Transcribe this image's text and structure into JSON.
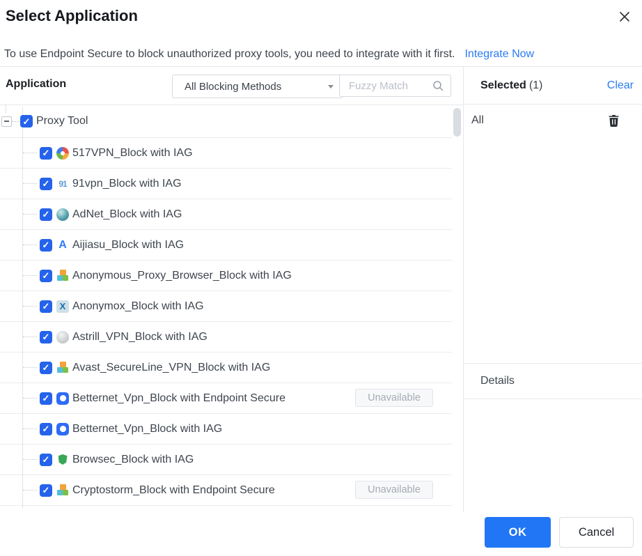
{
  "dialog": {
    "title": "Select Application"
  },
  "info": {
    "message": "To use Endpoint Secure to block unauthorized proxy tools, you need to integrate with it first.",
    "link_label": "Integrate Now"
  },
  "left": {
    "header": "Application",
    "dropdown_value": "All Blocking Methods",
    "search_placeholder": "Fuzzy Match"
  },
  "tree": {
    "parent": {
      "label": "Proxy Tool",
      "checked": true,
      "expanded": true
    },
    "children": [
      {
        "icon": "pinwheel-icon",
        "label": "517VPN_Block with IAG",
        "checked": true
      },
      {
        "icon": "vpn91-icon",
        "label": "91vpn_Block with IAG",
        "checked": true
      },
      {
        "icon": "globe-icon",
        "label": "AdNet_Block with IAG",
        "checked": true
      },
      {
        "icon": "letter-a-icon",
        "label": "Aijiasu_Block with IAG",
        "checked": true
      },
      {
        "icon": "cubes-icon",
        "label": "Anonymous_Proxy_Browser_Block with IAG",
        "checked": true
      },
      {
        "icon": "x-square-icon",
        "label": "Anonymox_Block with IAG",
        "checked": true
      },
      {
        "icon": "sphere-icon",
        "label": "Astrill_VPN_Block with IAG",
        "checked": true
      },
      {
        "icon": "cubes-icon",
        "label": "Avast_SecureLine_VPN_Block with IAG",
        "checked": true
      },
      {
        "icon": "shield-face-icon",
        "label": "Betternet_Vpn_Block with Endpoint Secure",
        "checked": true,
        "badge": "Unavailable"
      },
      {
        "icon": "shield-face-icon",
        "label": "Betternet_Vpn_Block with IAG",
        "checked": true
      },
      {
        "icon": "green-shield-icon",
        "label": "Browsec_Block with IAG",
        "checked": true
      },
      {
        "icon": "cubes-icon",
        "label": "Cryptostorm_Block with Endpoint Secure",
        "checked": true,
        "badge": "Unavailable"
      }
    ]
  },
  "right": {
    "selected_label": "Selected",
    "selected_count": "(1)",
    "clear_label": "Clear",
    "items": [
      {
        "label": "All"
      }
    ],
    "details_label": "Details"
  },
  "footer": {
    "ok_label": "OK",
    "cancel_label": "Cancel"
  },
  "colors": {
    "accent_blue": "#2A7BF5",
    "checkbox_blue": "#2563EB",
    "ok_button_blue": "#2176F5",
    "unavailable_text": "#A6ABB3",
    "row_border": "#E9ECEF",
    "panel_border": "#E5E8EC"
  }
}
